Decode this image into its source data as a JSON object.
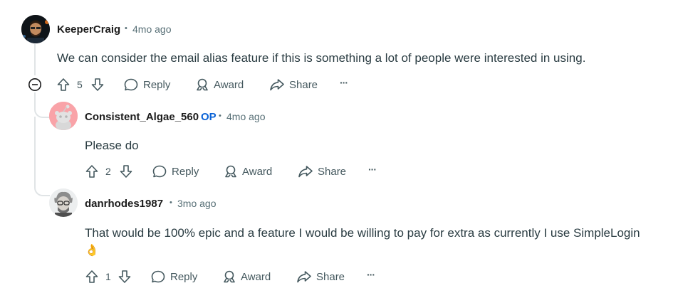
{
  "comments": [
    {
      "username": "KeeperCraig",
      "time": "4mo ago",
      "body": "We can consider the email alias feature if this is something a lot of people were interested in using.",
      "votes": "5",
      "actions": {
        "reply": "Reply",
        "award": "Award",
        "share": "Share",
        "more": "···"
      }
    },
    {
      "username": "Consistent_Algae_560",
      "op_badge": "OP",
      "time": "4mo ago",
      "body": "Please do",
      "votes": "2",
      "actions": {
        "reply": "Reply",
        "award": "Award",
        "share": "Share",
        "more": "···"
      }
    },
    {
      "username": "danrhodes1987",
      "time": "3mo ago",
      "body": "That would be 100% epic and a feature I would be willing to pay for extra as currently I use SimpleLogin",
      "emoji": "👌",
      "votes": "1",
      "actions": {
        "reply": "Reply",
        "award": "Award",
        "share": "Share",
        "more": "···"
      }
    }
  ],
  "separator": "•",
  "colors": {
    "op": "#0a62d6",
    "meta": "#576f76",
    "thread_line": "#e0e4e6"
  },
  "icons": [
    "avatar",
    "collapse-icon",
    "upvote-icon",
    "downvote-icon",
    "reply-icon",
    "award-icon",
    "share-icon",
    "more-icon"
  ]
}
